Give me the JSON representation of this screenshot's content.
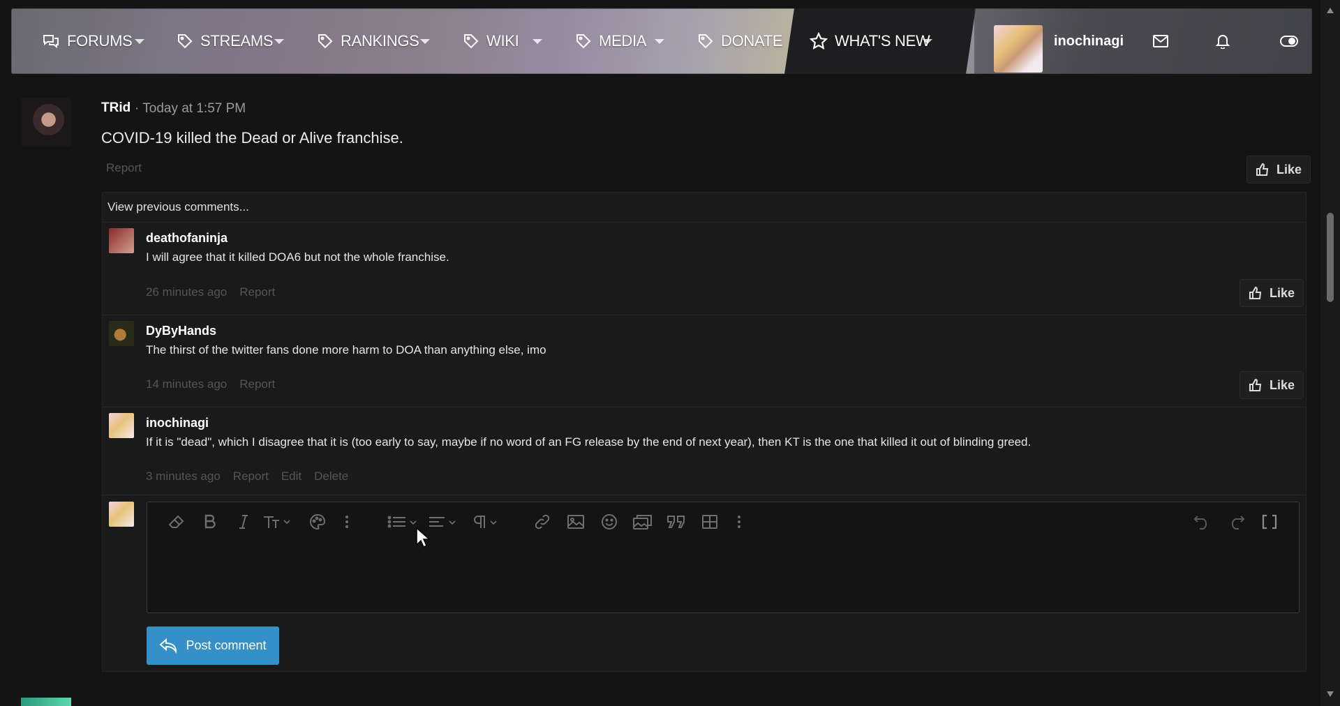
{
  "nav": {
    "items": [
      {
        "label": "FORUMS",
        "icon": "chat-bubbles-icon"
      },
      {
        "label": "STREAMS",
        "icon": "tag-icon"
      },
      {
        "label": "RANKINGS",
        "icon": "tag-icon"
      },
      {
        "label": "WIKI",
        "icon": "tag-icon"
      },
      {
        "label": "MEDIA",
        "icon": "tag-icon"
      },
      {
        "label": "DONATE",
        "icon": "tag-icon"
      },
      {
        "label": "WHAT'S NEW",
        "icon": "star-icon"
      }
    ],
    "username": "inochinagi"
  },
  "post": {
    "author": "TRid",
    "time": "· Today at 1:57 PM",
    "body": "COVID-19 killed the Dead or Alive franchise.",
    "report": "Report",
    "like": "Like"
  },
  "comments": {
    "view_previous": "View previous comments...",
    "items": [
      {
        "author": "deathofaninja",
        "text": "I will agree that it killed DOA6 but not the whole franchise.",
        "time": "26 minutes ago",
        "report": "Report",
        "like": "Like"
      },
      {
        "author": "DyByHands",
        "text": "The thirst of the twitter fans done more harm to DOA than anything else, imo",
        "time": "14 minutes ago",
        "report": "Report",
        "like": "Like"
      },
      {
        "author": "inochinagi",
        "text": "If it is \"dead\", which I disagree that it is (too early to say, maybe if no word of an FG release by the end of next year), then KT is the one that killed it out of blinding greed.",
        "time": "3 minutes ago",
        "report": "Report",
        "edit": "Edit",
        "delete": "Delete"
      }
    ]
  },
  "editor": {
    "post_button": "Post comment"
  }
}
